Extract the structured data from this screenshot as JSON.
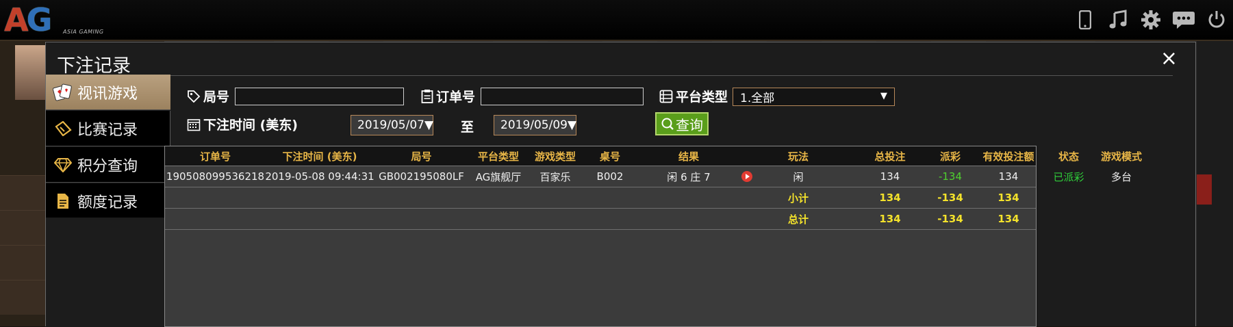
{
  "app": {
    "logo": {
      "text": "AG",
      "tagline": "ASIA GAMING"
    },
    "top_icons": [
      "mobile-icon",
      "music-icon",
      "gear-icon",
      "chat-icon",
      "power-icon"
    ]
  },
  "modal": {
    "title": "下注记录",
    "close": "×"
  },
  "sidebar": {
    "items": [
      {
        "label": "视讯游戏",
        "icon": "cards-icon",
        "active": true
      },
      {
        "label": "比赛记录",
        "icon": "ticket-icon",
        "active": false
      },
      {
        "label": "积分查询",
        "icon": "diamond-icon",
        "active": false
      },
      {
        "label": "额度记录",
        "icon": "document-icon",
        "active": false
      }
    ]
  },
  "filters": {
    "round_label": "局号",
    "round_value": "",
    "order_label": "订单号",
    "order_value": "",
    "platform_label": "平台类型",
    "platform_value": "1.全部",
    "time_label": "下注时间 (美东)",
    "date_from": "2019/05/07▼",
    "to_label": "至",
    "date_to": "2019/05/09▼",
    "query_button": "查询"
  },
  "table": {
    "headers": [
      "订单号",
      "下注时间 (美东)",
      "局号",
      "平台类型",
      "游戏类型",
      "桌号",
      "结果",
      "玩法",
      "总投注",
      "派彩",
      "有效投注额",
      "状态",
      "游戏模式"
    ],
    "rows": [
      {
        "order_no": "190508099536218",
        "bet_time": "2019-05-08 09:44:31",
        "round_no": "GB002195080LF",
        "platform": "AG旗舰厅",
        "game_type": "百家乐",
        "table_no": "B002",
        "result": "闲 6 庄 7",
        "play": "闲",
        "total_bet": "134",
        "payout": "-134",
        "valid_bet": "134",
        "status": "已派彩",
        "mode": "多台"
      }
    ],
    "subtotal": {
      "label": "小计",
      "total_bet": "134",
      "payout": "-134",
      "valid_bet": "134"
    },
    "total": {
      "label": "总计",
      "total_bet": "134",
      "payout": "-134",
      "valid_bet": "134"
    }
  },
  "colors": {
    "header_text": "#e8b647",
    "summary_text": "#f4e22b",
    "negative": "#4fd12f",
    "status_paid": "#2fcf3a",
    "query_button": "#5a9e1b",
    "active_tab": "#b9a07f"
  }
}
